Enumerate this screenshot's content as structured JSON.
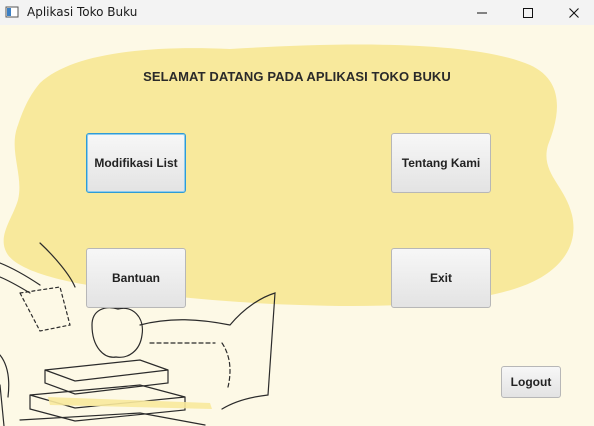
{
  "window": {
    "title": "Aplikasi Toko Buku",
    "controls": {
      "minimize": "minimize-icon",
      "maximize": "maximize-icon",
      "close": "close-icon"
    }
  },
  "main": {
    "heading": "SELAMAT DATANG PADA APLIKASI TOKO BUKU",
    "buttons": {
      "modifikasi_list": "Modifikasi List",
      "tentang_kami": "Tentang Kami",
      "bantuan": "Bantuan",
      "exit": "Exit",
      "logout": "Logout"
    },
    "focused_button": "Modifikasi List"
  },
  "colors": {
    "background": "#fdf9e6",
    "blob": "#f8e99c",
    "focus": "#2f9bd6"
  }
}
